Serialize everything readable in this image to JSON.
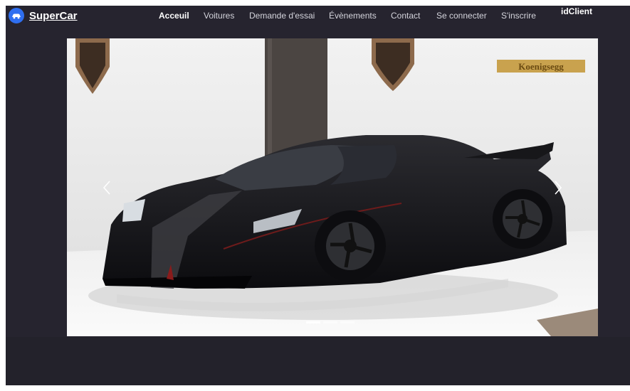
{
  "brand": {
    "name": "SuperCar",
    "icon": "car-icon"
  },
  "nav": {
    "items": [
      {
        "label": "Acceuil",
        "active": true
      },
      {
        "label": "Voitures",
        "active": false
      },
      {
        "label": "Demande d'essai",
        "active": false
      },
      {
        "label": "Évènements",
        "active": false
      },
      {
        "label": "Contact",
        "active": false
      },
      {
        "label": "Se connecter",
        "active": false
      },
      {
        "label": "S'inscrire",
        "active": false
      }
    ],
    "client_label": "idClient"
  },
  "carousel": {
    "image_subject": "black Koenigsegg supercar in showroom",
    "wall_logo_text": "Koenigsegg",
    "prev_icon": "chevron-left-icon",
    "next_icon": "chevron-right-icon",
    "indicator_count": 3,
    "active_index": 0
  },
  "colors": {
    "background": "#26242f",
    "brand_logo": "#2f6ff0",
    "text": "#ffffff"
  }
}
